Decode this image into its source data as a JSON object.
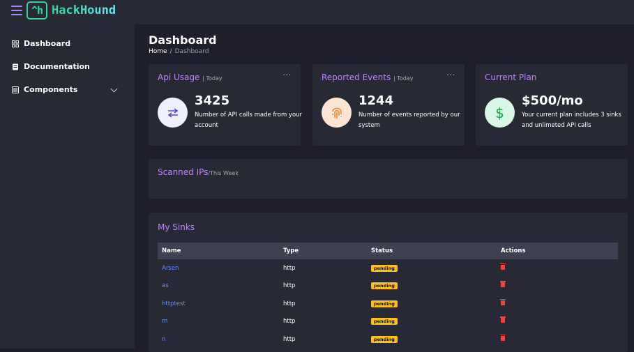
{
  "app": {
    "brand_mark": "^h",
    "brand_name": "HackHound"
  },
  "sidebar": {
    "items": [
      {
        "label": "Dashboard",
        "icon": "grid-icon"
      },
      {
        "label": "Documentation",
        "icon": "book-icon"
      },
      {
        "label": "Components",
        "icon": "list-icon"
      }
    ]
  },
  "page": {
    "title": "Dashboard",
    "breadcrumb_home": "Home",
    "breadcrumb_sep": "/",
    "breadcrumb_current": "Dashboard"
  },
  "cards": {
    "api_usage": {
      "title": "Api Usage",
      "period": "| Today",
      "value": "3425",
      "desc": "Number of API calls made from your account",
      "menu": "...",
      "icon": "swap-arrows-icon"
    },
    "reported_events": {
      "title": "Reported Events",
      "period": "| Today",
      "value": "1244",
      "desc": "Number of events reported by our system",
      "menu": "...",
      "icon": "fingerprint-icon"
    },
    "current_plan": {
      "title": "Current Plan",
      "value": "$500/mo",
      "desc": "Your current plan includes 3 sinks and unlimeted API calls",
      "icon": "dollar-icon"
    }
  },
  "scanned": {
    "title": "Scanned IPs",
    "period": "/This Week"
  },
  "sinks": {
    "title": "My Sinks",
    "columns": [
      "Name",
      "Type",
      "Status",
      "Actions"
    ],
    "rows": [
      {
        "name": "Arsen",
        "type": "http",
        "status": "pending"
      },
      {
        "name": "as",
        "type": "http",
        "status": "pending"
      },
      {
        "name": "httptest",
        "type": "http",
        "status": "pending"
      },
      {
        "name": "m",
        "type": "http",
        "status": "pending"
      },
      {
        "name": "n",
        "type": "http",
        "status": "pending"
      }
    ]
  },
  "colors": {
    "accent": "#c084fc",
    "link": "#6e8bff",
    "badge": "#fbbf24",
    "danger": "#ef4444"
  }
}
